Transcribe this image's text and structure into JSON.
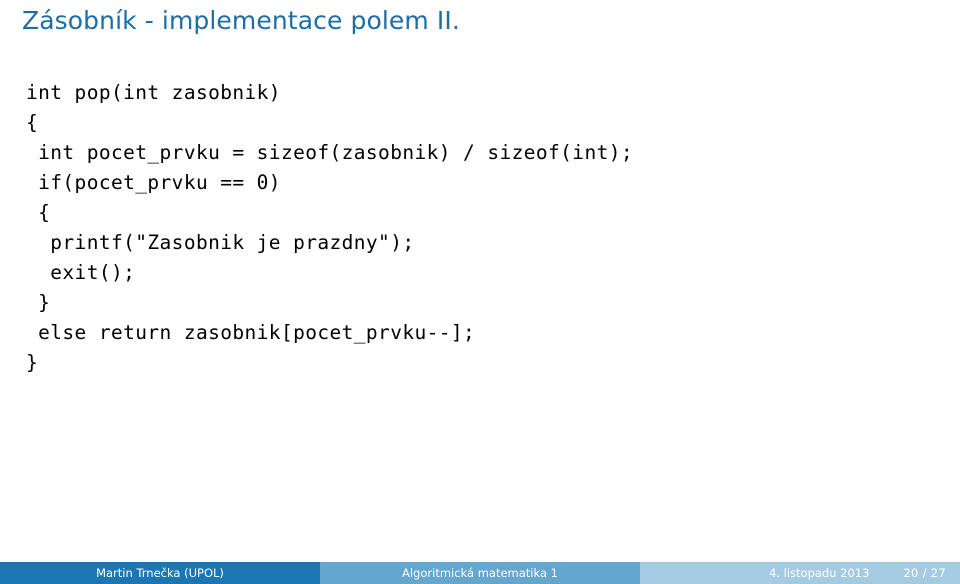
{
  "slide": {
    "title": "Zásobník - implementace polem II.",
    "title_color": "#1E6DA4",
    "background_color": "#ffffff"
  },
  "code": {
    "language": "c",
    "lines": [
      "int pop(int zasobnik)",
      "{",
      " int pocet_prvku = sizeof(zasobnik) / sizeof(int);",
      " if(pocet_prvku == 0)",
      " {",
      "  printf(\"Zasobnik je prazdny\");",
      "  exit();",
      " }",
      " else return zasobnik[pocet_prvku--];",
      "}"
    ]
  },
  "footer": {
    "author": "Martin Trnečka  (UPOL)",
    "subject": "Algoritmická matematika 1",
    "date": "4. listopadu 2013",
    "page": "20 / 27",
    "colors": {
      "author_bg": "#1B76B3",
      "subject_bg": "#64A6CE",
      "meta_bg": "#A5CBE3",
      "text": "#ffffff"
    }
  }
}
